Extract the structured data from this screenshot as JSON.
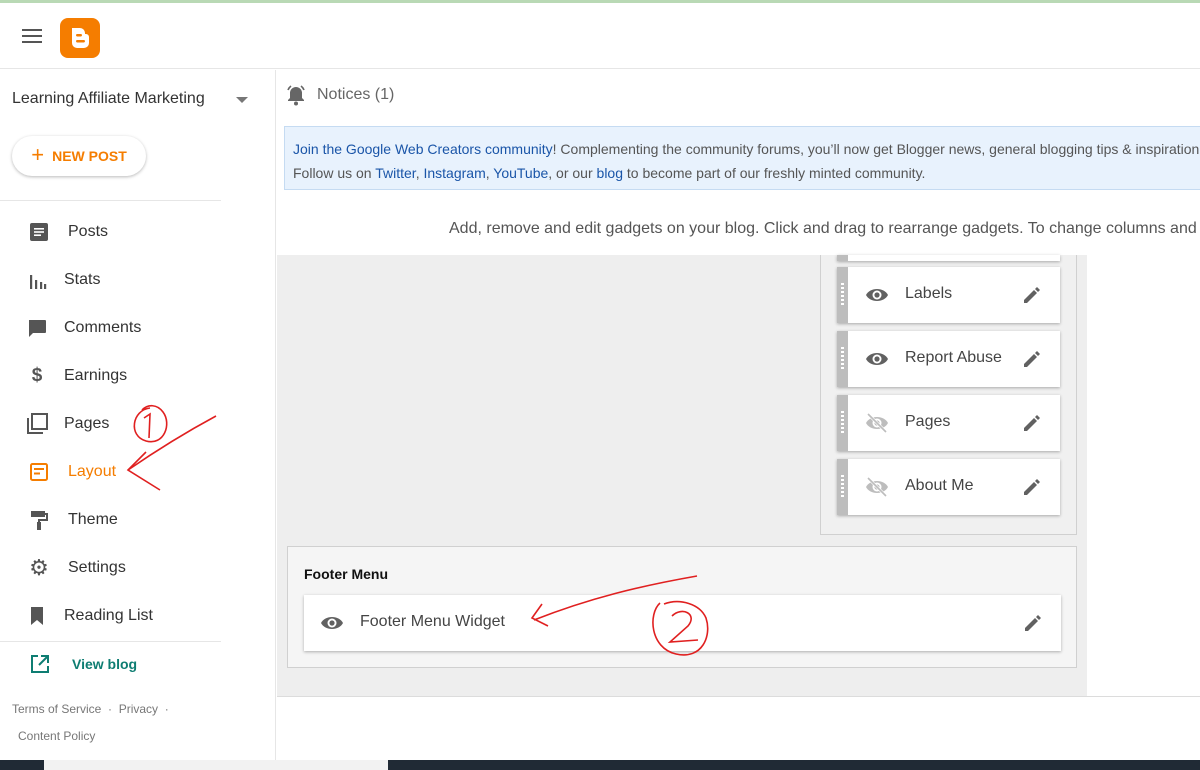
{
  "app": {
    "logo": "blogger-logo",
    "accent": "#f57d00"
  },
  "sidebar": {
    "blog_name": "Learning Affiliate Marketing",
    "new_post_label": "NEW POST",
    "items": [
      {
        "label": "Posts",
        "icon": "posts-icon"
      },
      {
        "label": "Stats",
        "icon": "stats-icon"
      },
      {
        "label": "Comments",
        "icon": "comments-icon"
      },
      {
        "label": "Earnings",
        "icon": "dollar-icon"
      },
      {
        "label": "Pages",
        "icon": "pages-icon"
      },
      {
        "label": "Layout",
        "icon": "layout-icon",
        "active": true
      },
      {
        "label": "Theme",
        "icon": "paint-roller-icon"
      },
      {
        "label": "Settings",
        "icon": "gear-icon"
      },
      {
        "label": "Reading List",
        "icon": "bookmark-icon"
      }
    ],
    "view_blog_label": "View blog",
    "footer": {
      "terms": "Terms of Service",
      "privacy": "Privacy",
      "separator": "·",
      "content_policy": "Content Policy"
    }
  },
  "main": {
    "notices_label": "Notices (1)",
    "banner": {
      "link1": "Join the Google Web Creators community",
      "text1": "! Complementing the community forums, you’ll now get Blogger news, general blogging tips & inspiration,",
      "text2": "Follow us on ",
      "twitter": "Twitter",
      "comma1": ", ",
      "instagram": "Instagram",
      "comma2": ", ",
      "youtube": "YouTube",
      "text3": ", or our ",
      "blog": "blog",
      "text4": " to become part of our freshly minted community."
    },
    "instructions": "Add, remove and edit gadgets on your blog. Click and drag to rearrange gadgets. To change columns and w",
    "sidebar_gadgets": [
      {
        "name": "Labels",
        "visible": true
      },
      {
        "name": "Report Abuse",
        "visible": true
      },
      {
        "name": "Pages",
        "visible": false
      },
      {
        "name": "About Me",
        "visible": false
      }
    ],
    "footer_section": {
      "title": "Footer Menu",
      "gadget_name": "Footer Menu Widget"
    }
  },
  "annotations": {
    "mark1": "1",
    "mark2": "2",
    "color": "#e02020"
  }
}
